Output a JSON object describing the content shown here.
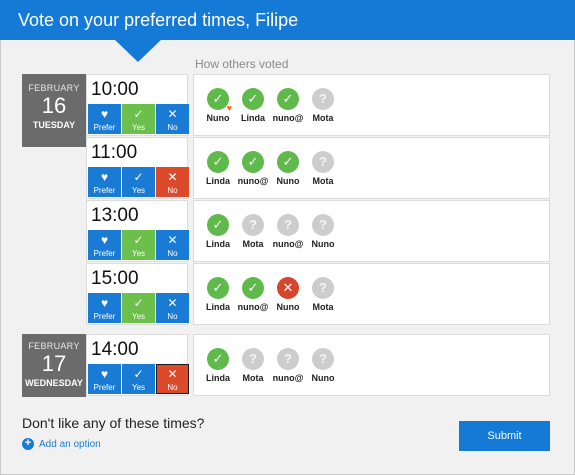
{
  "header": {
    "title": "Vote on your preferred times, Filipe"
  },
  "others_label": "How others voted",
  "days": [
    {
      "month": "FEBRUARY",
      "day": "16",
      "weekday": "TUESDAY"
    },
    {
      "month": "FEBRUARY",
      "day": "17",
      "weekday": "WEDNESDAY"
    }
  ],
  "button_labels": {
    "prefer": "Prefer",
    "yes": "Yes",
    "no": "No"
  },
  "icons": {
    "prefer": "heart-icon",
    "yes": "checkmark-icon",
    "no": "x-icon",
    "unknown": "question-icon"
  },
  "colors": {
    "brand": "#1579d6",
    "yes": "#5fb94b",
    "no": "#d5462c",
    "unknown": "#cdcdcd",
    "prefer_badge": "#ef6a18"
  },
  "slots": [
    {
      "time": "10:00",
      "my_vote": "yes",
      "voters": [
        {
          "name": "Nuno",
          "vote": "yes",
          "prefer": true
        },
        {
          "name": "Linda",
          "vote": "yes",
          "prefer": false
        },
        {
          "name": "nuno@",
          "vote": "yes",
          "prefer": false
        },
        {
          "name": "Mota",
          "vote": "unknown",
          "prefer": false
        }
      ]
    },
    {
      "time": "11:00",
      "my_vote": "no",
      "voters": [
        {
          "name": "Linda",
          "vote": "yes",
          "prefer": false
        },
        {
          "name": "nuno@",
          "vote": "yes",
          "prefer": false
        },
        {
          "name": "Nuno",
          "vote": "yes",
          "prefer": false
        },
        {
          "name": "Mota",
          "vote": "unknown",
          "prefer": false
        }
      ]
    },
    {
      "time": "13:00",
      "my_vote": "yes",
      "voters": [
        {
          "name": "Linda",
          "vote": "yes",
          "prefer": false
        },
        {
          "name": "Mota",
          "vote": "unknown",
          "prefer": false
        },
        {
          "name": "nuno@",
          "vote": "unknown",
          "prefer": false
        },
        {
          "name": "Nuno",
          "vote": "unknown",
          "prefer": false
        }
      ]
    },
    {
      "time": "15:00",
      "my_vote": "yes",
      "voters": [
        {
          "name": "Linda",
          "vote": "yes",
          "prefer": false
        },
        {
          "name": "nuno@",
          "vote": "yes",
          "prefer": false
        },
        {
          "name": "Nuno",
          "vote": "no",
          "prefer": false
        },
        {
          "name": "Mota",
          "vote": "unknown",
          "prefer": false
        }
      ]
    },
    {
      "time": "14:00",
      "my_vote": "no",
      "voters": [
        {
          "name": "Linda",
          "vote": "yes",
          "prefer": false
        },
        {
          "name": "Mota",
          "vote": "unknown",
          "prefer": false
        },
        {
          "name": "nuno@",
          "vote": "unknown",
          "prefer": false
        },
        {
          "name": "Nuno",
          "vote": "unknown",
          "prefer": false
        }
      ]
    }
  ],
  "footer": {
    "question": "Don't like any of these times?",
    "add_option": "Add an option",
    "submit": "Submit"
  }
}
